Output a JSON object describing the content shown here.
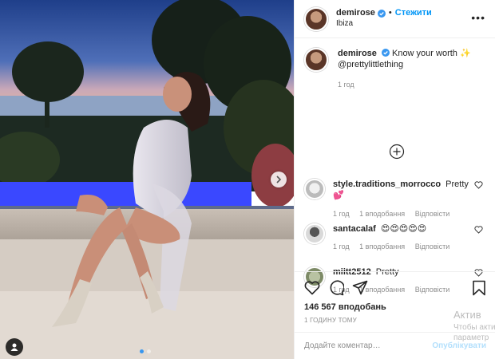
{
  "header": {
    "username": "demirose",
    "separator": "•",
    "follow_label": "Стежити",
    "location": "Ibiza",
    "more_icon": "more-horizontal-icon"
  },
  "caption": {
    "username": "demirose",
    "text": "Know your worth ✨ @prettylittlething",
    "time": "1 год"
  },
  "comments": [
    {
      "username": "style.traditions_morrocco",
      "text": "Pretty 💕",
      "time": "1 год",
      "likes": "1 вподобання",
      "reply": "Відповісти"
    },
    {
      "username": "santacalaf",
      "text": "😍😍😍😍😍",
      "time": "1 год",
      "likes": "1 вподобання",
      "reply": "Відповісти"
    },
    {
      "username": "miitt2512",
      "text": "Pretty",
      "time": "1 год",
      "likes": "1 вподобання",
      "reply": "Відповісти"
    }
  ],
  "stats": {
    "likes": "146 567 вподобань",
    "posted": "1 ГОДИНУ ТОМУ"
  },
  "add_comment": {
    "placeholder": "Додайте коментар…",
    "publish": "Опублікувати"
  },
  "watermark": {
    "line1": "Актив",
    "line2": "Чтобы акти",
    "line3": "параметр"
  },
  "colors": {
    "accent": "#0095f6",
    "muted": "#8e8e8e",
    "border": "#efefef",
    "pool": "#3a48ff"
  }
}
